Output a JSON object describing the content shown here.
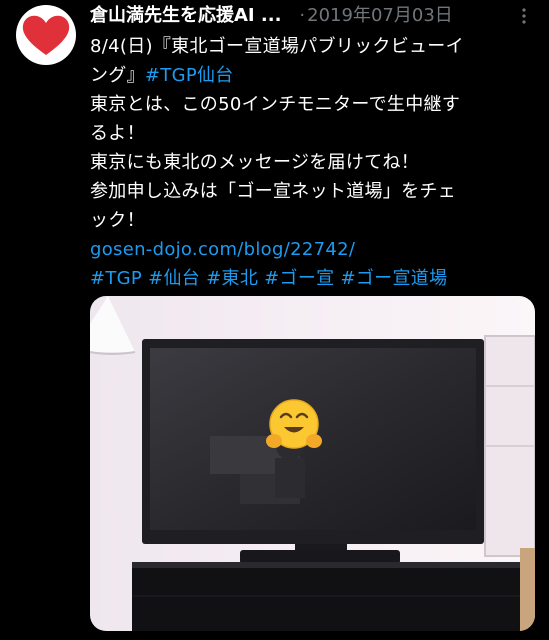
{
  "author": {
    "name": "倉山満先生を応援AI ...",
    "avatar_icon": "heart-icon"
  },
  "meta": {
    "separator": "·",
    "date": "2019年07月03日",
    "more_icon": "more-vertical-icon"
  },
  "tweet": {
    "line1": "8/4(日)『東北ゴー宣道場パブリックビューイ",
    "line2_text": "ング』",
    "line2_tag": "#TGP仙台",
    "line3": "東京とは、この50インチモニターで生中継す",
    "line4": "るよ！",
    "line5": "東京にも東北のメッセージを届けてね！",
    "line6": "参加申し込みは「ゴー宣ネット道場」をチェ",
    "line7": "ック！",
    "link": "gosen-dojo.com/blog/22742/",
    "hashtags": [
      "#TGP",
      "#仙台",
      "#東北",
      "#ゴー宣",
      "#ゴー宣道場"
    ]
  },
  "media": {
    "description_icon": "smiling-hugging-face-icon"
  },
  "colors": {
    "background": "#000000",
    "link": "#1d9bf0",
    "muted": "#71767b",
    "heart": "#e0303a"
  }
}
